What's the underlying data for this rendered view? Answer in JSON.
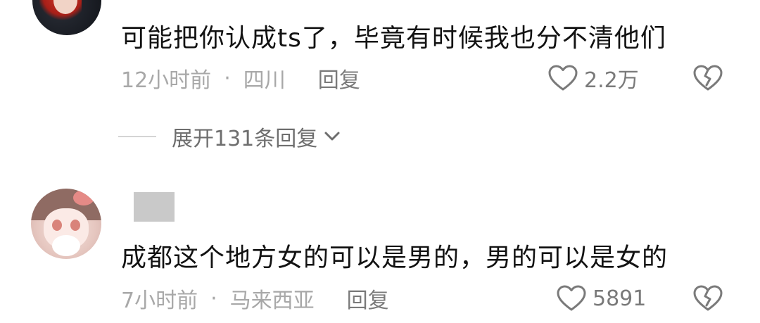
{
  "comments": [
    {
      "text": "可能把你认成ts了，毕竟有时候我也分不清他们",
      "time": "12小时前",
      "separator": "·",
      "location": "四川",
      "reply_label": "回复",
      "likes": "2.2万",
      "replies": {
        "expand_label": "展开131条回复"
      }
    },
    {
      "text": "成都这个地方女的可以是男的，男的可以是女的",
      "time": "7小时前",
      "separator": "·",
      "location": "马来西亚",
      "reply_label": "回复",
      "likes": "5891"
    }
  ],
  "icons": {
    "like": "heart-outline-icon",
    "dislike": "broken-heart-icon",
    "expand": "chevron-down-icon"
  },
  "colors": {
    "text": "#121212",
    "meta": "#a8a8a8",
    "action": "#7a7a7a"
  }
}
